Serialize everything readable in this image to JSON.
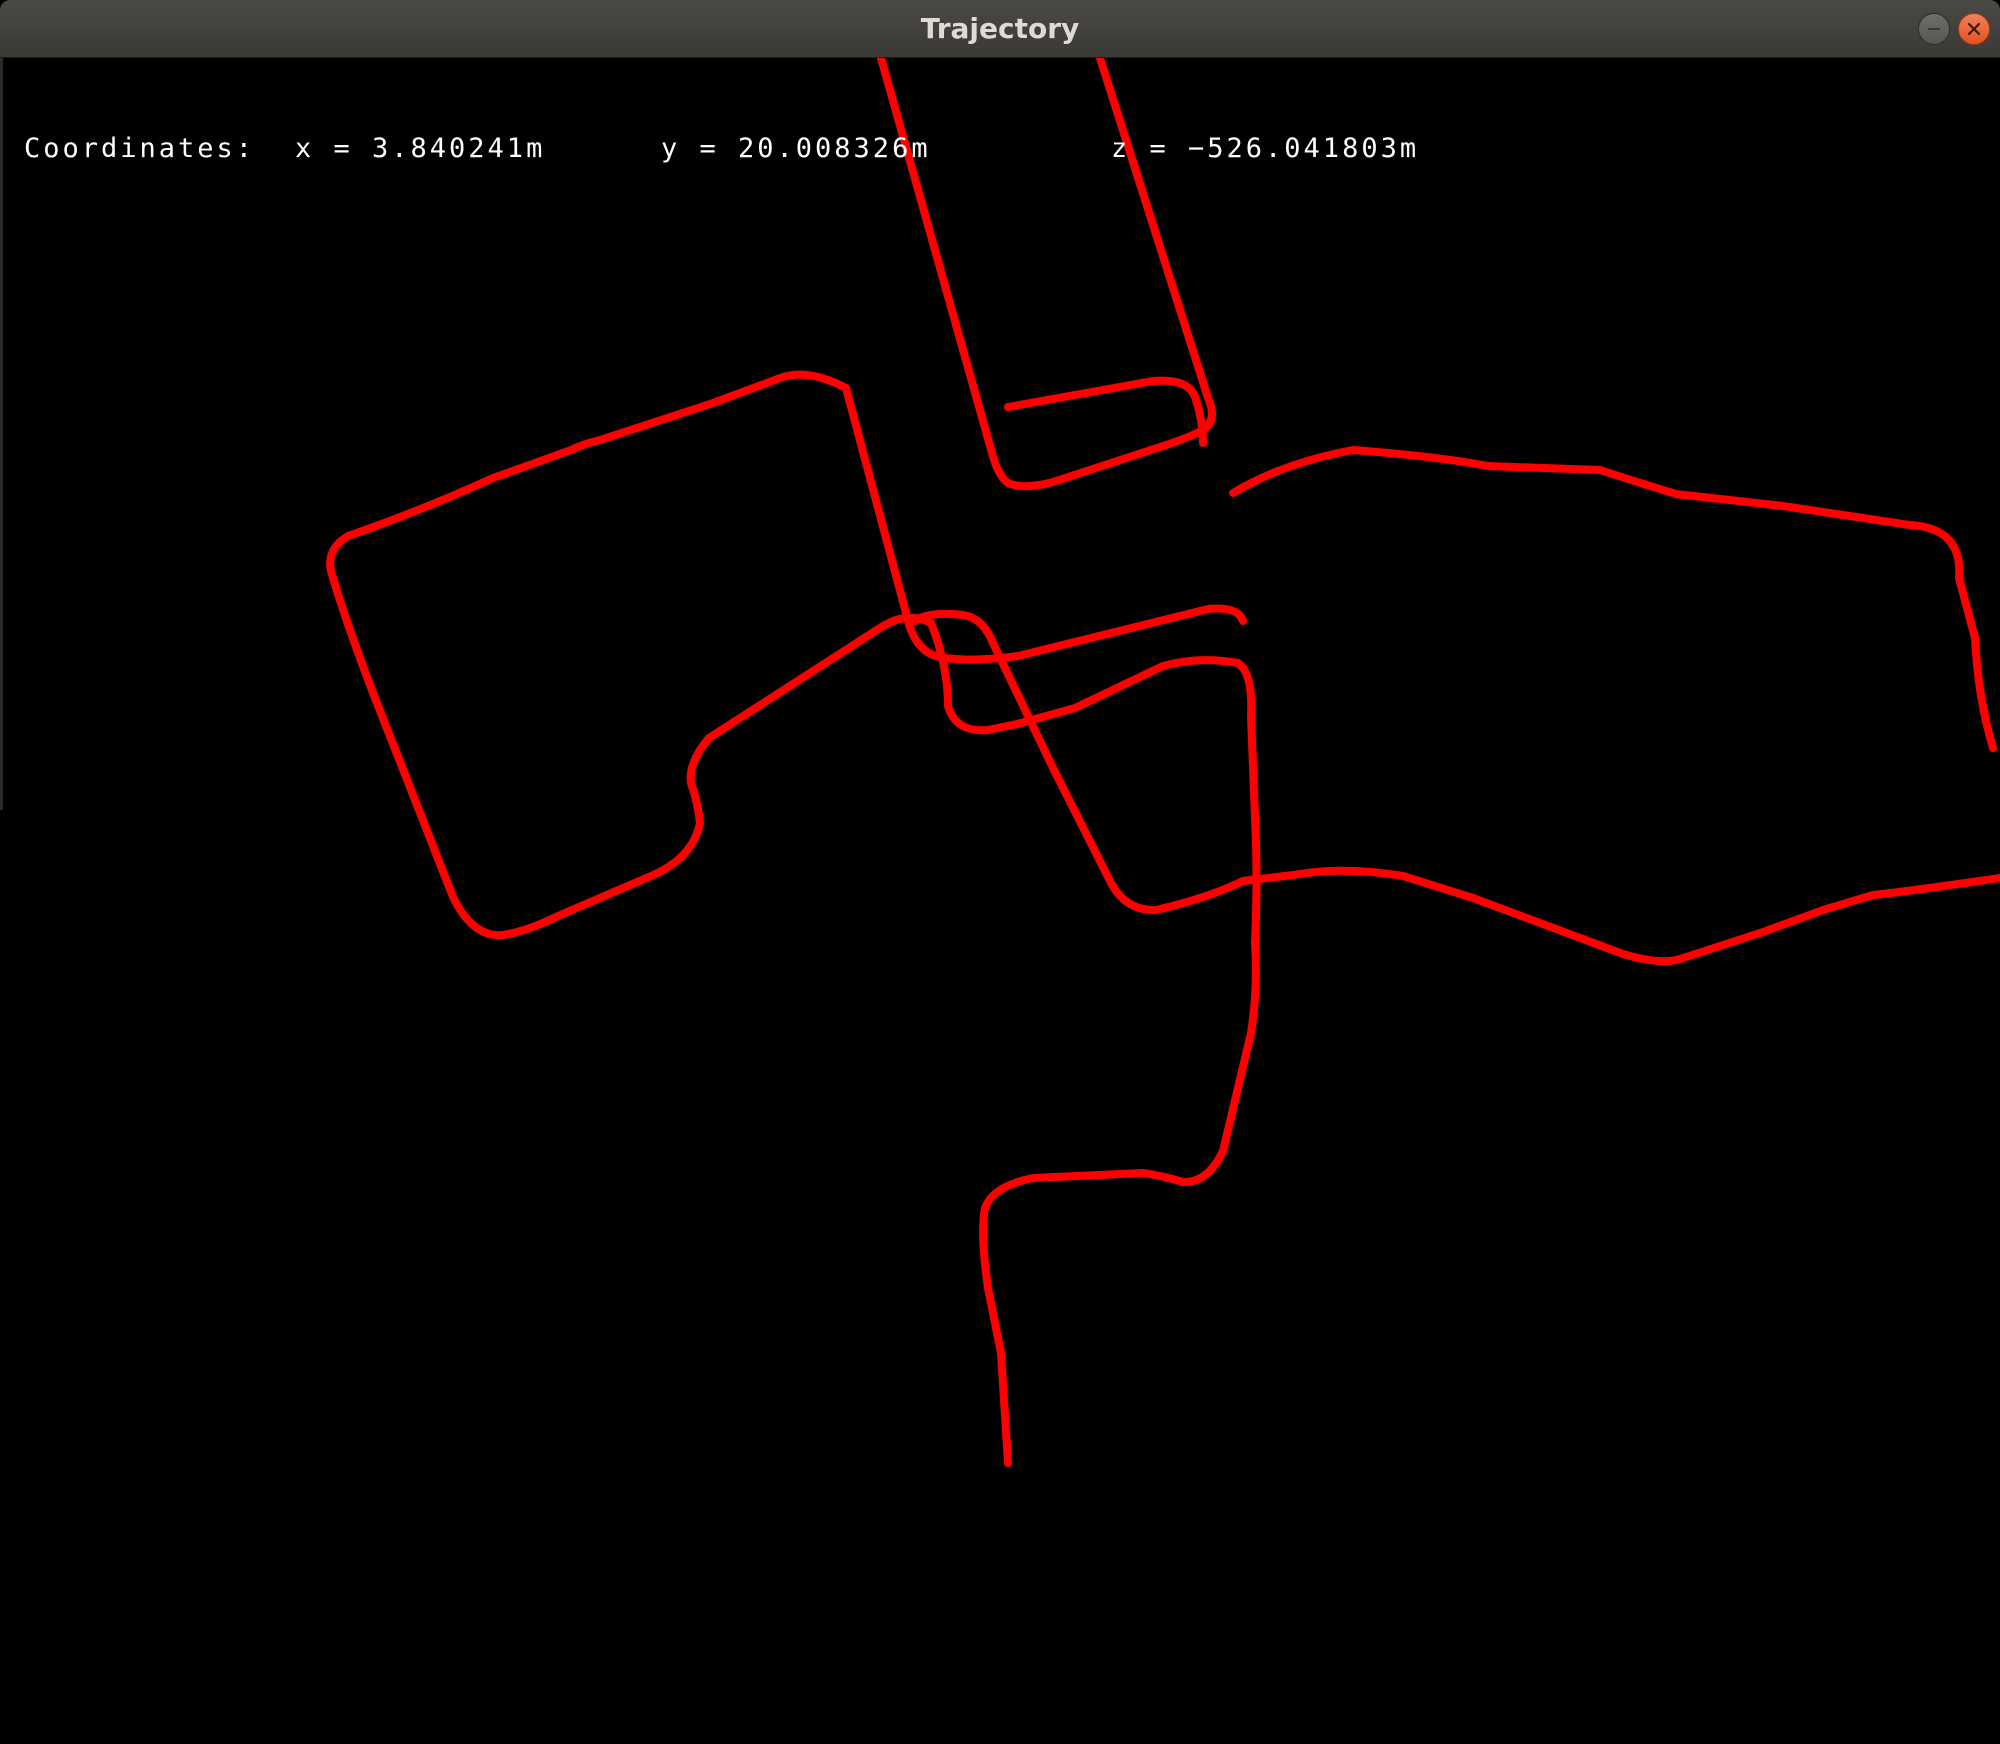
{
  "window": {
    "title": "Trajectory",
    "buttons": {
      "minimize": "minimize-icon",
      "close": "close-icon"
    }
  },
  "coordinates": {
    "label": "Coordinates:",
    "x": "x = 3.840241m",
    "y": "y = 20.008326m",
    "z": "z = −526.041803m"
  },
  "trajectory": {
    "color": "#ff0000"
  },
  "colors": {
    "background": "#000000",
    "titlebar": "#3d3c39",
    "title_text": "#dfdbd2",
    "close_button": "#e95420"
  }
}
